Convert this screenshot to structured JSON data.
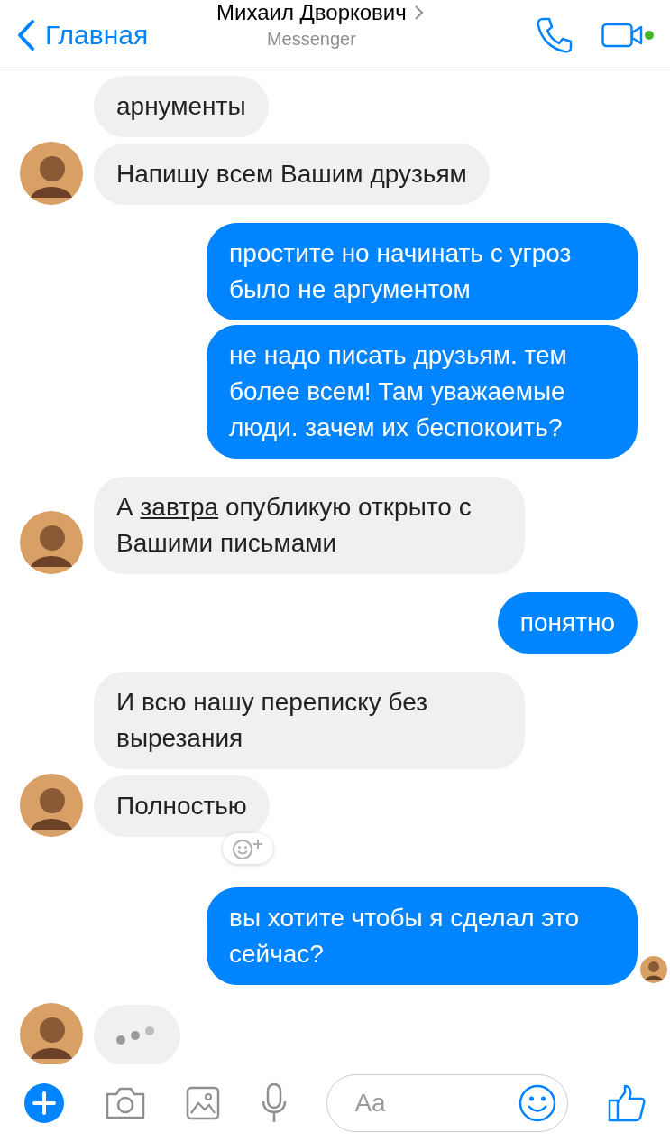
{
  "header": {
    "back_label": "Главная",
    "title": "Михаил Дворкович",
    "subtitle": "Messenger",
    "online": true
  },
  "messages": [
    {
      "kind": "text",
      "outgoing": false,
      "show_avatar": false,
      "parts": [
        {
          "text": "арнументы",
          "underlined": false
        }
      ],
      "reaction_button": false
    },
    {
      "kind": "text",
      "outgoing": false,
      "show_avatar": true,
      "parts": [
        {
          "text": "Напишу всем Вашим друзьям",
          "underlined": false
        }
      ],
      "reaction_button": false
    },
    {
      "kind": "text",
      "outgoing": true,
      "parts": [
        {
          "text": "простите но начинать с угроз было не аргументом",
          "underlined": false
        }
      ],
      "reaction_button": false,
      "seen": false
    },
    {
      "kind": "text",
      "outgoing": true,
      "parts": [
        {
          "text": "не надо писать друзьям. тем более всем! Там уважаемые люди. зачем их беспокоить?",
          "underlined": false
        }
      ],
      "reaction_button": false,
      "seen": false
    },
    {
      "kind": "text",
      "outgoing": false,
      "show_avatar": true,
      "parts": [
        {
          "text": "А ",
          "underlined": false
        },
        {
          "text": "завтра",
          "underlined": true
        },
        {
          "text": " опубликую открыто с Вашими письмами",
          "underlined": false
        }
      ],
      "reaction_button": false
    },
    {
      "kind": "text",
      "outgoing": true,
      "parts": [
        {
          "text": "понятно",
          "underlined": false
        }
      ],
      "reaction_button": false,
      "seen": false
    },
    {
      "kind": "text",
      "outgoing": false,
      "show_avatar": false,
      "parts": [
        {
          "text": "И всю нашу переписку без вырезания",
          "underlined": false
        }
      ],
      "reaction_button": false
    },
    {
      "kind": "text",
      "outgoing": false,
      "show_avatar": true,
      "parts": [
        {
          "text": "Полностью",
          "underlined": false
        }
      ],
      "reaction_button": true
    },
    {
      "kind": "text",
      "outgoing": true,
      "parts": [
        {
          "text": "вы хотите чтобы я сделал это сейчас?",
          "underlined": false
        }
      ],
      "reaction_button": false,
      "seen": true
    },
    {
      "kind": "typing",
      "outgoing": false,
      "show_avatar": true
    }
  ],
  "composer": {
    "placeholder": "Aa"
  }
}
